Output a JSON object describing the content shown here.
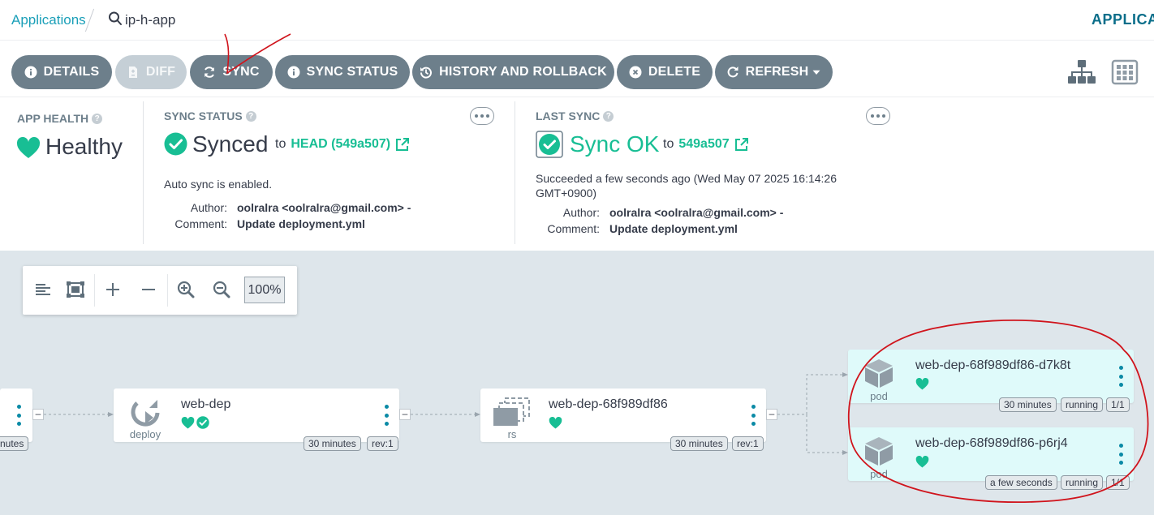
{
  "breadcrumb": {
    "applications": "Applications",
    "app_name": "ip-h-app"
  },
  "header_right": "APPLICA",
  "toolbar": {
    "details": "DETAILS",
    "diff": "DIFF",
    "sync": "SYNC",
    "sync_status": "SYNC STATUS",
    "history": "HISTORY AND ROLLBACK",
    "delete": "DELETE",
    "refresh": "REFRESH"
  },
  "app_health": {
    "label": "APP HEALTH",
    "value": "Healthy",
    "color": "#18be94"
  },
  "sync_status": {
    "label": "SYNC STATUS",
    "value": "Synced",
    "to": "to",
    "revision": "HEAD (549a507)",
    "auto_sync": "Auto sync is enabled.",
    "author_label": "Author:",
    "author": "oolralra <oolralra@gmail.com> -",
    "comment_label": "Comment:",
    "comment": "Update deployment.yml"
  },
  "last_sync": {
    "label": "LAST SYNC",
    "value": "Sync OK",
    "to": "to",
    "revision": "549a507",
    "succeeded_line1": "Succeeded a few seconds ago (Wed May 07 2025 16:14:26",
    "succeeded_line2": "GMT+0900)",
    "author_label": "Author:",
    "author": "oolralra <oolralra@gmail.com> -",
    "comment_label": "Comment:",
    "comment": "Update deployment.yml"
  },
  "zoom": {
    "level": "100%"
  },
  "nodes": {
    "partial": {
      "tag": "nutes"
    },
    "deploy": {
      "name": "web-dep",
      "kind": "deploy",
      "age": "30 minutes",
      "rev": "rev:1"
    },
    "rs": {
      "name": "web-dep-68f989df86",
      "kind": "rs",
      "age": "30 minutes",
      "rev": "rev:1"
    },
    "pod1": {
      "name": "web-dep-68f989df86-d7k8t",
      "kind": "pod",
      "age": "30 minutes",
      "status": "running",
      "ready": "1/1"
    },
    "pod2": {
      "name": "web-dep-68f989df86-p6rj4",
      "kind": "pod",
      "age": "a few seconds",
      "status": "running",
      "ready": "1/1"
    }
  },
  "collapse_symbol": "–",
  "colors": {
    "accent": "#18be94",
    "button": "#6d7f8b",
    "canvas": "#dee6eb",
    "pod_bg": "#dffafa",
    "annotation": "#d0141c"
  }
}
